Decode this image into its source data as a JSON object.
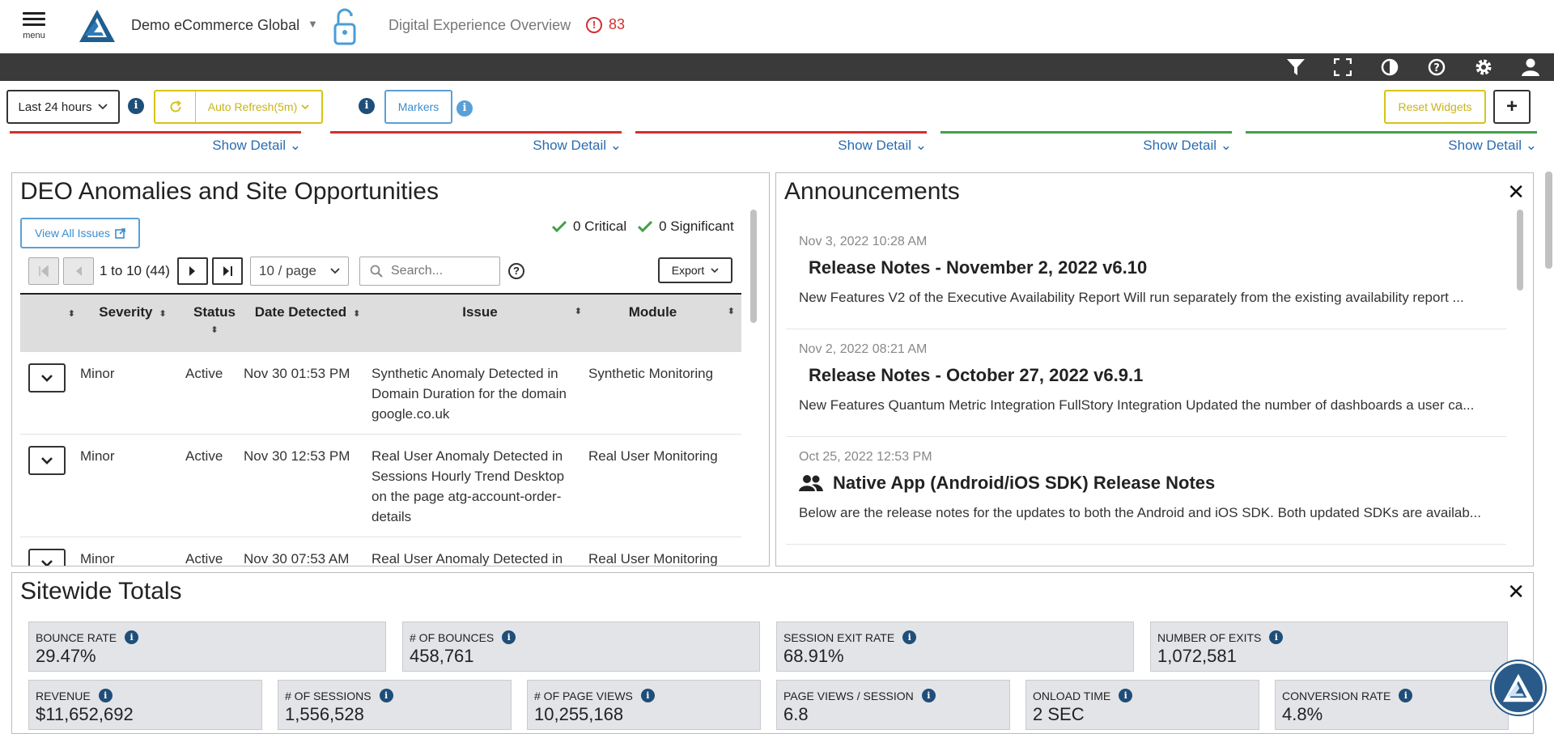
{
  "header": {
    "menu_label": "menu",
    "account_name": "Demo eCommerce Global",
    "dashboard_title": "Digital Experience Overview",
    "alert_count": "83"
  },
  "controls": {
    "time_range": "Last 24 hours",
    "auto_refresh": "Auto Refresh(5m)",
    "markers": "Markers",
    "reset_widgets": "Reset Widgets",
    "add_label": "+"
  },
  "show_detail": {
    "label": "Show Detail",
    "colors": [
      "#d32f2f",
      "#d32f2f",
      "#d32f2f",
      "#43a047",
      "#43a047"
    ]
  },
  "anomalies": {
    "title": "DEO Anomalies and Site Opportunities",
    "view_all": "View All Issues",
    "critical": "0 Critical",
    "significant": "0 Significant",
    "pager_text": "1 to 10 (44)",
    "page_size": "10 / page",
    "search_placeholder": "Search...",
    "export": "Export",
    "columns": [
      "Severity",
      "Status",
      "Date Detected",
      "Issue",
      "Module"
    ],
    "rows": [
      {
        "severity": "Minor",
        "status": "Active",
        "date": "Nov 30 01:53 PM",
        "issue": "Synthetic Anomaly Detected in Domain Duration for the domain google.co.uk",
        "module": "Synthetic Monitoring"
      },
      {
        "severity": "Minor",
        "status": "Active",
        "date": "Nov 30 12:53 PM",
        "issue": "Real User Anomaly Detected in Sessions Hourly Trend Desktop on the page atg-account-order-details",
        "module": "Real User Monitoring"
      },
      {
        "severity": "Minor",
        "status": "Active",
        "date": "Nov 30 07:53 AM",
        "issue": "Real User Anomaly Detected in",
        "module": "Real User Monitoring"
      }
    ]
  },
  "announcements": {
    "title": "Announcements",
    "items": [
      {
        "date": "Nov 3, 2022 10:28 AM",
        "title": "Release Notes - November 2, 2022 v6.10",
        "desc": "New Features V2 of the Executive Availability Report Will run separately from the existing availability report ..."
      },
      {
        "date": "Nov 2, 2022 08:21 AM",
        "title": "Release Notes - October 27, 2022 v6.9.1",
        "desc": "New Features Quantum Metric Integration FullStory Integration Updated the number of dashboards a user ca..."
      },
      {
        "date": "Oct 25, 2022 12:53 PM",
        "title": "Native App (Android/iOS SDK) Release Notes",
        "desc": "Below are the release notes for the updates to both the Android and iOS SDK. Both updated SDKs are availab..."
      }
    ]
  },
  "sitewide": {
    "title": "Sitewide Totals",
    "row1": [
      {
        "label": "BOUNCE RATE",
        "value": "29.47%"
      },
      {
        "label": "# OF BOUNCES",
        "value": "458,761"
      },
      {
        "label": "SESSION EXIT RATE",
        "value": "68.91%"
      },
      {
        "label": "NUMBER OF EXITS",
        "value": "1,072,581"
      }
    ],
    "row2": [
      {
        "label": "REVENUE",
        "value": "$11,652,692"
      },
      {
        "label": "# OF SESSIONS",
        "value": "1,556,528"
      },
      {
        "label": "# OF PAGE VIEWS",
        "value": "10,255,168"
      },
      {
        "label": "PAGE VIEWS / SESSION",
        "value": "6.8"
      },
      {
        "label": "ONLOAD TIME",
        "value": "2 SEC"
      },
      {
        "label": "CONVERSION RATE",
        "value": "4.8%"
      }
    ]
  }
}
